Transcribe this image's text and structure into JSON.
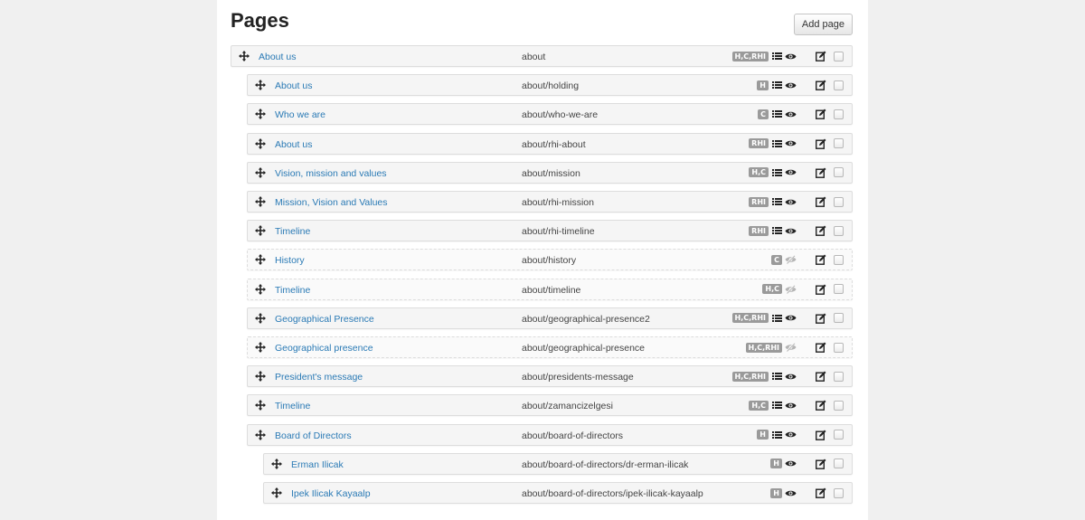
{
  "header": {
    "title": "Pages",
    "add_button_label": "Add page"
  },
  "colors": {
    "link": "#2a7ab5",
    "badge": "#9a9a9a",
    "row_bg": "#f5f5f5",
    "row_border": "#dddddd"
  },
  "icons": {
    "move": "move-arrows-icon",
    "list": "list-icon",
    "visible": "eye-icon",
    "hidden": "eye-slash-icon",
    "edit": "edit-icon",
    "select": "checkbox"
  },
  "pages": [
    {
      "title": "About us",
      "path": "about",
      "badge": "H,C,RHI",
      "level": 0,
      "list": true,
      "visible": true
    },
    {
      "title": "About us",
      "path": "about/holding",
      "badge": "H",
      "level": 1,
      "list": true,
      "visible": true
    },
    {
      "title": "Who we are",
      "path": "about/who-we-are",
      "badge": "C",
      "level": 1,
      "list": true,
      "visible": true
    },
    {
      "title": "About us",
      "path": "about/rhi-about",
      "badge": "RHI",
      "level": 1,
      "list": true,
      "visible": true
    },
    {
      "title": "Vision, mission and values",
      "path": "about/mission",
      "badge": "H,C",
      "level": 1,
      "list": true,
      "visible": true
    },
    {
      "title": "Mission, Vision and Values",
      "path": "about/rhi-mission",
      "badge": "RHI",
      "level": 1,
      "list": true,
      "visible": true
    },
    {
      "title": "Timeline",
      "path": "about/rhi-timeline",
      "badge": "RHI",
      "level": 1,
      "list": true,
      "visible": true
    },
    {
      "title": "History",
      "path": "about/history",
      "badge": "C",
      "level": 1,
      "list": false,
      "visible": false
    },
    {
      "title": "Timeline",
      "path": "about/timeline",
      "badge": "H,C",
      "level": 1,
      "list": false,
      "visible": false
    },
    {
      "title": "Geographical Presence",
      "path": "about/geographical-presence2",
      "badge": "H,C,RHI",
      "level": 1,
      "list": true,
      "visible": true
    },
    {
      "title": "Geographical presence",
      "path": "about/geographical-presence",
      "badge": "H,C,RHI",
      "level": 1,
      "list": false,
      "visible": false
    },
    {
      "title": "President's message",
      "path": "about/presidents-message",
      "badge": "H,C,RHI",
      "level": 1,
      "list": true,
      "visible": true
    },
    {
      "title": "Timeline",
      "path": "about/zamancizelgesi",
      "badge": "H,C",
      "level": 1,
      "list": true,
      "visible": true
    },
    {
      "title": "Board of Directors",
      "path": "about/board-of-directors",
      "badge": "H",
      "level": 1,
      "list": true,
      "visible": true
    },
    {
      "title": "Erman Ilicak",
      "path": "about/board-of-directors/dr-erman-ilicak",
      "badge": "H",
      "level": 2,
      "list": false,
      "visible": true
    },
    {
      "title": "Ipek Ilicak Kayaalp",
      "path": "about/board-of-directors/ipek-ilicak-kayaalp",
      "badge": "H",
      "level": 2,
      "list": false,
      "visible": true
    }
  ]
}
